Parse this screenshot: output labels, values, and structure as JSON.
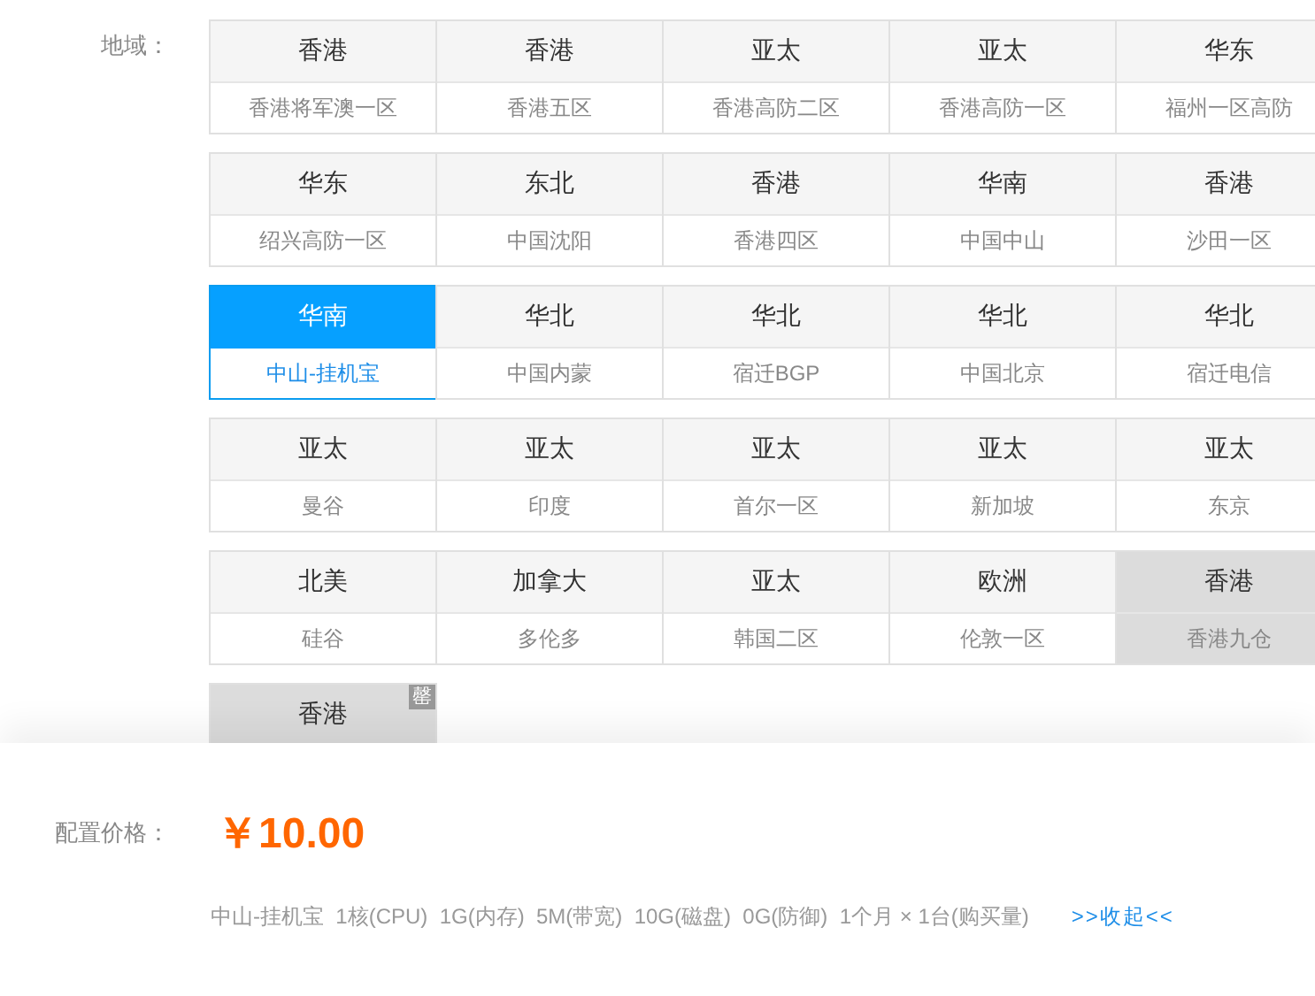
{
  "region_label": "地域：",
  "regions": [
    {
      "area": "香港",
      "name": "香港将军澳一区",
      "selected": false,
      "sold_out": false
    },
    {
      "area": "香港",
      "name": "香港五区",
      "selected": false,
      "sold_out": false
    },
    {
      "area": "亚太",
      "name": "香港高防二区",
      "selected": false,
      "sold_out": false
    },
    {
      "area": "亚太",
      "name": "香港高防一区",
      "selected": false,
      "sold_out": false
    },
    {
      "area": "华东",
      "name": "福州一区高防",
      "selected": false,
      "sold_out": false
    },
    {
      "area": "华东",
      "name": "绍兴高防一区",
      "selected": false,
      "sold_out": false
    },
    {
      "area": "东北",
      "name": "中国沈阳",
      "selected": false,
      "sold_out": false
    },
    {
      "area": "香港",
      "name": "香港四区",
      "selected": false,
      "sold_out": false
    },
    {
      "area": "华南",
      "name": "中国中山",
      "selected": false,
      "sold_out": false
    },
    {
      "area": "香港",
      "name": "沙田一区",
      "selected": false,
      "sold_out": false
    },
    {
      "area": "华南",
      "name": "中山-挂机宝",
      "selected": true,
      "sold_out": false
    },
    {
      "area": "华北",
      "name": "中国内蒙",
      "selected": false,
      "sold_out": false
    },
    {
      "area": "华北",
      "name": "宿迁BGP",
      "selected": false,
      "sold_out": false
    },
    {
      "area": "华北",
      "name": "中国北京",
      "selected": false,
      "sold_out": false
    },
    {
      "area": "华北",
      "name": "宿迁电信",
      "selected": false,
      "sold_out": false
    },
    {
      "area": "亚太",
      "name": "曼谷",
      "selected": false,
      "sold_out": false
    },
    {
      "area": "亚太",
      "name": "印度",
      "selected": false,
      "sold_out": false
    },
    {
      "area": "亚太",
      "name": "首尔一区",
      "selected": false,
      "sold_out": false
    },
    {
      "area": "亚太",
      "name": "新加坡",
      "selected": false,
      "sold_out": false
    },
    {
      "area": "亚太",
      "name": "东京",
      "selected": false,
      "sold_out": false
    },
    {
      "area": "北美",
      "name": "硅谷",
      "selected": false,
      "sold_out": false
    },
    {
      "area": "加拿大",
      "name": "多伦多",
      "selected": false,
      "sold_out": false
    },
    {
      "area": "亚太",
      "name": "韩国二区",
      "selected": false,
      "sold_out": false
    },
    {
      "area": "欧洲",
      "name": "伦敦一区",
      "selected": false,
      "sold_out": false
    },
    {
      "area": "香港",
      "name": "香港九仓",
      "selected": false,
      "sold_out": true
    },
    {
      "area": "香港",
      "badge": "罄",
      "selected": false,
      "sold_out": true
    }
  ],
  "price_label": "配置价格：",
  "price": "￥10.00",
  "summary": "中山-挂机宝  1核(CPU)  1G(内存)  5M(带宽)  10G(磁盘)  0G(防御)  1个月 × 1台(购买量)",
  "collapse_link": ">>收起<<"
}
